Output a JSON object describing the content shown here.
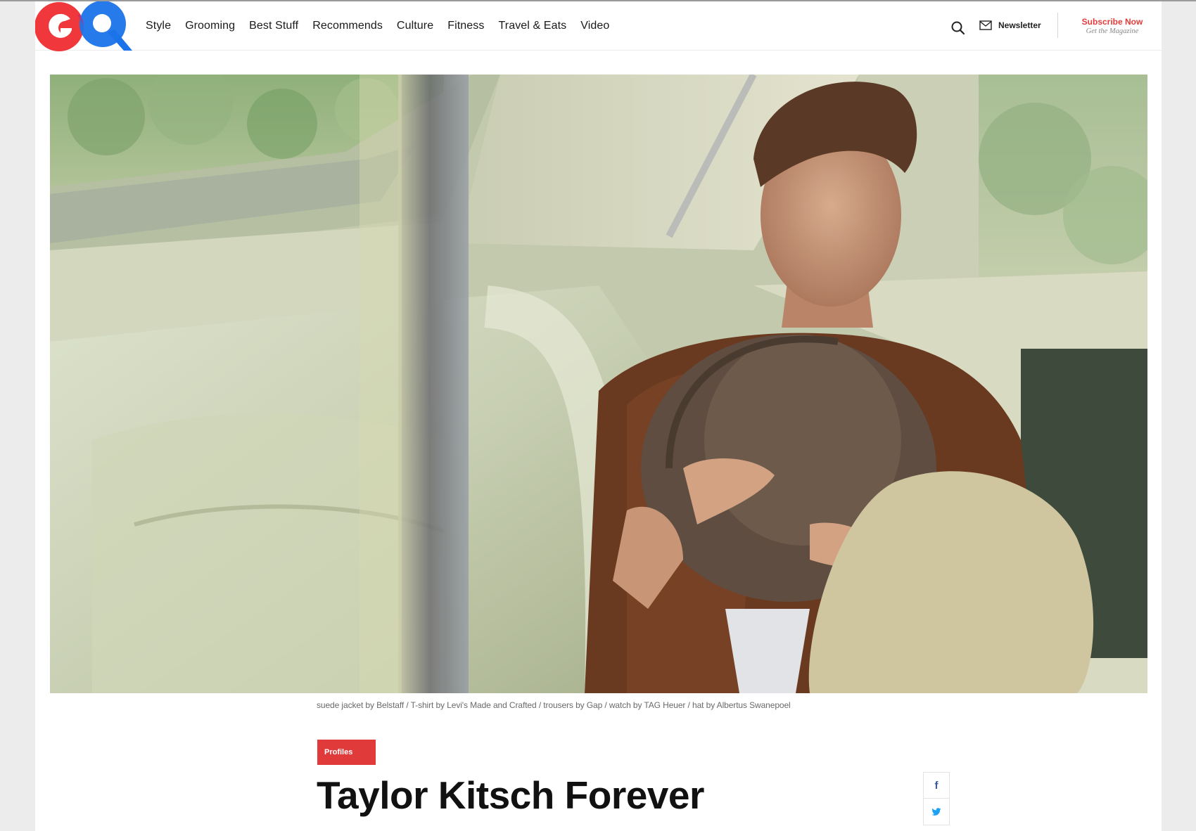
{
  "brand": {
    "logo_text": "GQ",
    "red": "#f0373c",
    "blue": "#1a73e8"
  },
  "nav": {
    "items": [
      {
        "label": "Style"
      },
      {
        "label": "Grooming"
      },
      {
        "label": "Best Stuff"
      },
      {
        "label": "Recommends"
      },
      {
        "label": "Culture"
      },
      {
        "label": "Fitness"
      },
      {
        "label": "Travel & Eats"
      },
      {
        "label": "Video"
      }
    ]
  },
  "header": {
    "search_icon": "search-icon",
    "newsletter_label": "Newsletter",
    "subscribe_title": "Subscribe Now",
    "subscribe_sub": "Get the Magazine"
  },
  "hero": {
    "caption": "suede jacket by Belstaff / T-shirt by Levi's Made and Crafted / trousers by Gap / watch by TAG Heuer / hat by Albertus Swanepoel"
  },
  "article": {
    "category": "Profiles",
    "headline": "Taylor Kitsch Forever",
    "accent_color": "#e03a3a"
  },
  "share": {
    "facebook_icon": "f",
    "twitter_icon": "twitter-icon"
  }
}
